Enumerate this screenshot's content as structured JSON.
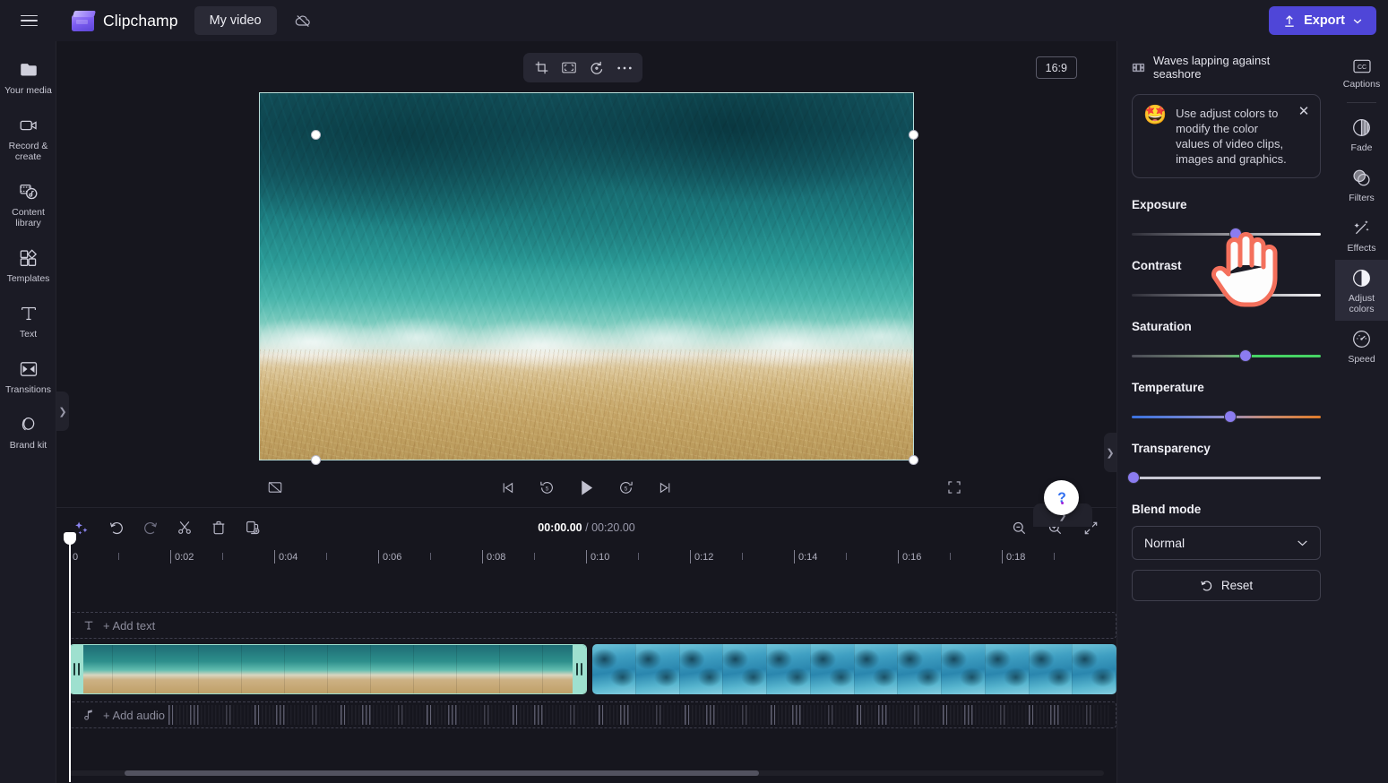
{
  "app": {
    "brand_name": "Clipchamp",
    "project_tab": "My video",
    "menu_icon": "hamburger-icon",
    "cloud_icon": "cloud-off-icon",
    "export_label": "Export",
    "export_icon": "upload-icon",
    "export_chevron": "chevron-down-icon",
    "accent_color": "#4f46d8"
  },
  "left_rail": {
    "items": [
      {
        "label": "Your media",
        "icon": "folder-media-icon"
      },
      {
        "label": "Record & create",
        "icon": "video-camera-icon"
      },
      {
        "label": "Content library",
        "icon": "content-library-icon"
      },
      {
        "label": "Templates",
        "icon": "templates-grid-icon"
      },
      {
        "label": "Text",
        "icon": "text-t-icon"
      },
      {
        "label": "Transitions",
        "icon": "transitions-icon"
      },
      {
        "label": "Brand kit",
        "icon": "brand-kit-icon"
      }
    ],
    "expand_chevron": "chevron-right-icon"
  },
  "stage": {
    "float_tools": [
      {
        "name": "crop",
        "icon": "crop-icon"
      },
      {
        "name": "fit-fill",
        "icon": "fit-frame-icon"
      },
      {
        "name": "rotate",
        "icon": "rotate-icon"
      },
      {
        "name": "more",
        "icon": "more-horizontal-icon"
      }
    ],
    "aspect_ratio": "16:9",
    "collapse_chevron": "chevron-down-icon",
    "help_label": "?",
    "player_controls": {
      "captions_toggle": "captions-off-icon",
      "skip_back": "skip-to-start-icon",
      "back_5": "rewind-5-icon",
      "play": "play-icon",
      "forward_5": "forward-5-icon",
      "skip_forward": "skip-to-end-icon",
      "fullscreen": "fullscreen-icon"
    }
  },
  "properties": {
    "clip_name": "Waves lapping against seashore",
    "clip_icon": "film-strip-icon",
    "tip": {
      "emoji": "🤩",
      "text": "Use adjust colors to modify the color values of video clips, images and graphics.",
      "close_icon": "close-icon"
    },
    "sliders": [
      {
        "label": "Exposure",
        "value_pct": 55,
        "track": "gray"
      },
      {
        "label": "Contrast",
        "value_pct": 55,
        "track": "gray"
      },
      {
        "label": "Saturation",
        "value_pct": 60,
        "track": "green"
      },
      {
        "label": "Temperature",
        "value_pct": 52,
        "track": "temp"
      },
      {
        "label": "Transparency",
        "value_pct": 0,
        "track": "plain"
      }
    ],
    "blend_mode_label": "Blend mode",
    "blend_mode_value": "Normal",
    "blend_mode_chevron": "chevron-down-icon",
    "reset_label": "Reset",
    "reset_icon": "undo-arrow-icon",
    "thumb_color": "#8b7cf0"
  },
  "tool_rail": {
    "items": [
      {
        "label": "Captions",
        "icon": "closed-captions-icon",
        "active": false
      },
      {
        "label": "Fade",
        "icon": "fade-circle-icon",
        "active": false
      },
      {
        "label": "Filters",
        "icon": "filters-overlap-icon",
        "active": false
      },
      {
        "label": "Effects",
        "icon": "magic-wand-icon",
        "active": false
      },
      {
        "label": "Adjust colors",
        "icon": "half-circle-contrast-icon",
        "active": true
      },
      {
        "label": "Speed",
        "icon": "speedometer-icon",
        "active": false
      }
    ]
  },
  "timeline": {
    "tools": [
      {
        "name": "auto-compose",
        "icon": "sparkle-icon"
      },
      {
        "name": "undo",
        "icon": "undo-icon"
      },
      {
        "name": "redo",
        "icon": "redo-icon"
      },
      {
        "name": "split",
        "icon": "scissors-icon"
      },
      {
        "name": "delete",
        "icon": "trash-icon"
      },
      {
        "name": "duplicate",
        "icon": "duplicate-icon"
      }
    ],
    "current_time": "00:00.00",
    "separator": "/",
    "total_time": "00:20.00",
    "zoom_tools": [
      {
        "name": "zoom-out",
        "icon": "zoom-out-icon"
      },
      {
        "name": "zoom-in",
        "icon": "zoom-in-icon"
      },
      {
        "name": "fit-timeline",
        "icon": "fit-to-screen-icon"
      }
    ],
    "ruler_labels": [
      "0",
      "0:02",
      "0:04",
      "0:06",
      "0:08",
      "0:10",
      "0:12",
      "0:14",
      "0:16",
      "0:18"
    ],
    "add_text_label": "+ Add text",
    "add_text_icon": "text-t-icon",
    "add_audio_label": "+ Add audio",
    "add_audio_icon": "music-note-icon",
    "clips": [
      {
        "name": "video-clip-1",
        "selected": true
      },
      {
        "name": "video-clip-2",
        "selected": false
      }
    ]
  }
}
